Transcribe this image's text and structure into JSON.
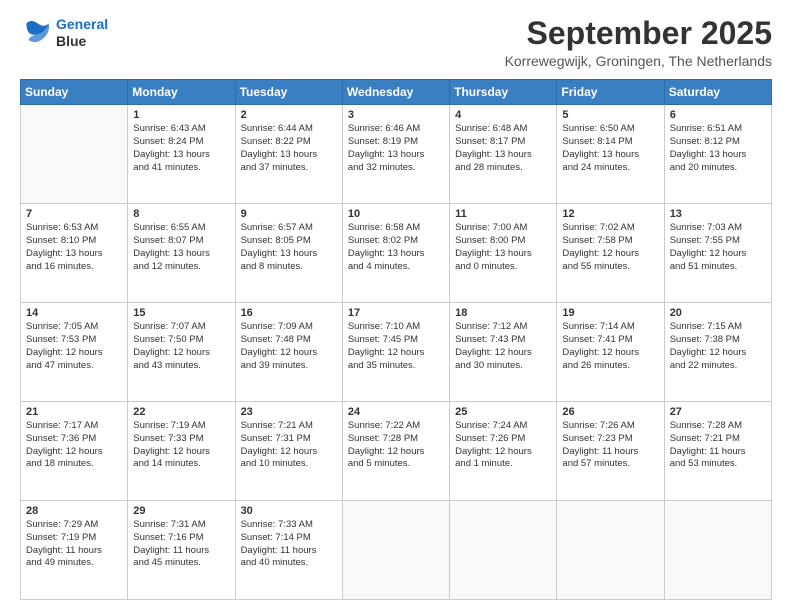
{
  "header": {
    "logo_line1": "General",
    "logo_line2": "Blue",
    "month_title": "September 2025",
    "location": "Korrewegwijk, Groningen, The Netherlands"
  },
  "days_of_week": [
    "Sunday",
    "Monday",
    "Tuesday",
    "Wednesday",
    "Thursday",
    "Friday",
    "Saturday"
  ],
  "weeks": [
    [
      {
        "day": "",
        "info": ""
      },
      {
        "day": "1",
        "info": "Sunrise: 6:43 AM\nSunset: 8:24 PM\nDaylight: 13 hours\nand 41 minutes."
      },
      {
        "day": "2",
        "info": "Sunrise: 6:44 AM\nSunset: 8:22 PM\nDaylight: 13 hours\nand 37 minutes."
      },
      {
        "day": "3",
        "info": "Sunrise: 6:46 AM\nSunset: 8:19 PM\nDaylight: 13 hours\nand 32 minutes."
      },
      {
        "day": "4",
        "info": "Sunrise: 6:48 AM\nSunset: 8:17 PM\nDaylight: 13 hours\nand 28 minutes."
      },
      {
        "day": "5",
        "info": "Sunrise: 6:50 AM\nSunset: 8:14 PM\nDaylight: 13 hours\nand 24 minutes."
      },
      {
        "day": "6",
        "info": "Sunrise: 6:51 AM\nSunset: 8:12 PM\nDaylight: 13 hours\nand 20 minutes."
      }
    ],
    [
      {
        "day": "7",
        "info": "Sunrise: 6:53 AM\nSunset: 8:10 PM\nDaylight: 13 hours\nand 16 minutes."
      },
      {
        "day": "8",
        "info": "Sunrise: 6:55 AM\nSunset: 8:07 PM\nDaylight: 13 hours\nand 12 minutes."
      },
      {
        "day": "9",
        "info": "Sunrise: 6:57 AM\nSunset: 8:05 PM\nDaylight: 13 hours\nand 8 minutes."
      },
      {
        "day": "10",
        "info": "Sunrise: 6:58 AM\nSunset: 8:02 PM\nDaylight: 13 hours\nand 4 minutes."
      },
      {
        "day": "11",
        "info": "Sunrise: 7:00 AM\nSunset: 8:00 PM\nDaylight: 13 hours\nand 0 minutes."
      },
      {
        "day": "12",
        "info": "Sunrise: 7:02 AM\nSunset: 7:58 PM\nDaylight: 12 hours\nand 55 minutes."
      },
      {
        "day": "13",
        "info": "Sunrise: 7:03 AM\nSunset: 7:55 PM\nDaylight: 12 hours\nand 51 minutes."
      }
    ],
    [
      {
        "day": "14",
        "info": "Sunrise: 7:05 AM\nSunset: 7:53 PM\nDaylight: 12 hours\nand 47 minutes."
      },
      {
        "day": "15",
        "info": "Sunrise: 7:07 AM\nSunset: 7:50 PM\nDaylight: 12 hours\nand 43 minutes."
      },
      {
        "day": "16",
        "info": "Sunrise: 7:09 AM\nSunset: 7:48 PM\nDaylight: 12 hours\nand 39 minutes."
      },
      {
        "day": "17",
        "info": "Sunrise: 7:10 AM\nSunset: 7:45 PM\nDaylight: 12 hours\nand 35 minutes."
      },
      {
        "day": "18",
        "info": "Sunrise: 7:12 AM\nSunset: 7:43 PM\nDaylight: 12 hours\nand 30 minutes."
      },
      {
        "day": "19",
        "info": "Sunrise: 7:14 AM\nSunset: 7:41 PM\nDaylight: 12 hours\nand 26 minutes."
      },
      {
        "day": "20",
        "info": "Sunrise: 7:15 AM\nSunset: 7:38 PM\nDaylight: 12 hours\nand 22 minutes."
      }
    ],
    [
      {
        "day": "21",
        "info": "Sunrise: 7:17 AM\nSunset: 7:36 PM\nDaylight: 12 hours\nand 18 minutes."
      },
      {
        "day": "22",
        "info": "Sunrise: 7:19 AM\nSunset: 7:33 PM\nDaylight: 12 hours\nand 14 minutes."
      },
      {
        "day": "23",
        "info": "Sunrise: 7:21 AM\nSunset: 7:31 PM\nDaylight: 12 hours\nand 10 minutes."
      },
      {
        "day": "24",
        "info": "Sunrise: 7:22 AM\nSunset: 7:28 PM\nDaylight: 12 hours\nand 5 minutes."
      },
      {
        "day": "25",
        "info": "Sunrise: 7:24 AM\nSunset: 7:26 PM\nDaylight: 12 hours\nand 1 minute."
      },
      {
        "day": "26",
        "info": "Sunrise: 7:26 AM\nSunset: 7:23 PM\nDaylight: 11 hours\nand 57 minutes."
      },
      {
        "day": "27",
        "info": "Sunrise: 7:28 AM\nSunset: 7:21 PM\nDaylight: 11 hours\nand 53 minutes."
      }
    ],
    [
      {
        "day": "28",
        "info": "Sunrise: 7:29 AM\nSunset: 7:19 PM\nDaylight: 11 hours\nand 49 minutes."
      },
      {
        "day": "29",
        "info": "Sunrise: 7:31 AM\nSunset: 7:16 PM\nDaylight: 11 hours\nand 45 minutes."
      },
      {
        "day": "30",
        "info": "Sunrise: 7:33 AM\nSunset: 7:14 PM\nDaylight: 11 hours\nand 40 minutes."
      },
      {
        "day": "",
        "info": ""
      },
      {
        "day": "",
        "info": ""
      },
      {
        "day": "",
        "info": ""
      },
      {
        "day": "",
        "info": ""
      }
    ]
  ]
}
